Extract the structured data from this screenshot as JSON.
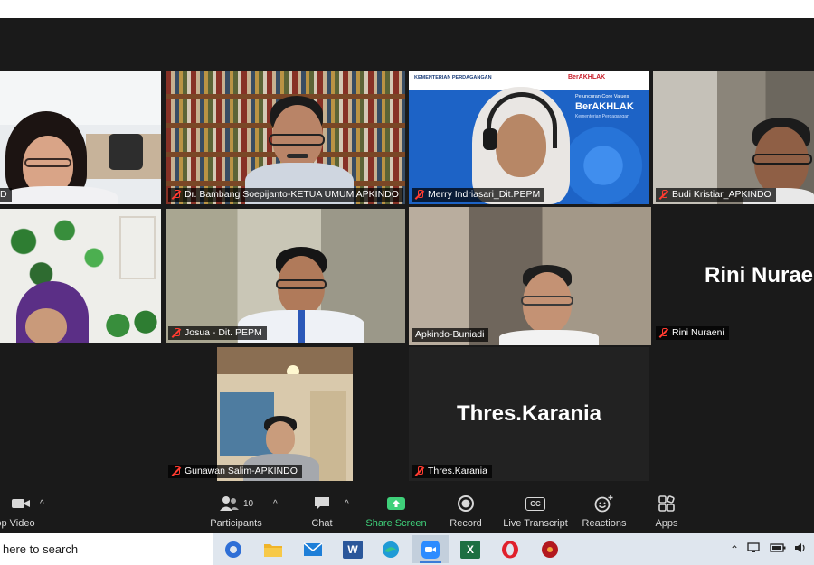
{
  "meeting": {
    "participants": [
      {
        "name": "Dr. Bambang Soepijanto-KETUA UMUM APKINDO",
        "muted": true
      },
      {
        "name": "Merry Indriasari_Dit.PEPM",
        "muted": true
      },
      {
        "name": "Budi Kristiar_APKINDO",
        "muted": true
      },
      {
        "name": "Josua - Dit. PEPM",
        "muted": true
      },
      {
        "name": "Apkindo-Buniadi",
        "muted": false,
        "active_speaker": true
      },
      {
        "name": "Rini Nuraeni",
        "muted": true,
        "video_off": true,
        "big_label": "Rini Nuraeni"
      },
      {
        "name": "Gunawan Salim-APKINDO",
        "muted": true
      },
      {
        "name": "Thres.Karania",
        "muted": true,
        "video_off": true,
        "big_label": "Thres.Karania"
      }
    ],
    "slide": {
      "ministry": "KEMENTERIAN PERDAGANGAN",
      "brand": "BerAKHLAK",
      "headline_small": "Peluncuran Core Values",
      "headline_big": "BerAKHLAK",
      "footer": "Kementerian Perdagangan"
    }
  },
  "toolbar": {
    "video_label": "op Video",
    "participants_label": "Participants",
    "participants_count": "10",
    "chat_label": "Chat",
    "share_label": "Share Screen",
    "record_label": "Record",
    "transcript_label": "Live Transcript",
    "transcript_icon_text": "CC",
    "reactions_label": "Reactions",
    "apps_label": "Apps"
  },
  "taskbar": {
    "search_text": "here to search",
    "apps": [
      "edge-legacy-icon",
      "file-explorer-icon",
      "mail-icon",
      "word-icon",
      "edge-icon",
      "zoom-icon",
      "excel-icon",
      "opera-icon",
      "app-icon"
    ],
    "word_letter": "W",
    "excel_letter": "X"
  },
  "colors": {
    "stage_bg": "#1a1a1a",
    "active_border": "#e6e84a",
    "muted_red": "#ff3b30",
    "share_green": "#3fd07a",
    "taskbar_bg": "#dfe6ee"
  }
}
